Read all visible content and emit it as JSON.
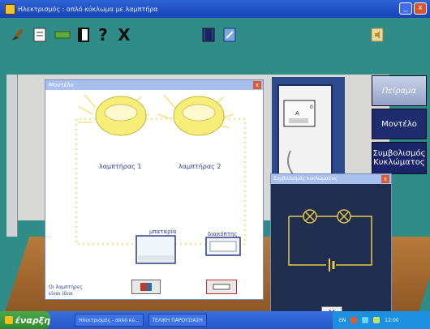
{
  "window": {
    "title": "Ηλεκτρισμός : απλό κύκλωμα με λαμπτήρα",
    "controls": {
      "minimize": "_",
      "close": "x"
    }
  },
  "toolbar": {
    "help_label": "?",
    "close_label": "X",
    "tools": [
      "brush-icon",
      "notepad-icon",
      "tape-icon",
      "book-icon",
      "help-icon",
      "close-icon",
      "door-icon",
      "notebook-icon",
      "speaker-icon"
    ]
  },
  "side_buttons": {
    "peirama": "Πείραμα",
    "montelo": "Μοντέλο",
    "symvolismos_line1": "Συμβολισμός",
    "symvolismos_line2": "Κυκλώματος"
  },
  "background_scene": {
    "meter_reading": "0"
  },
  "montelo_dialog": {
    "title": "Μοντέλο",
    "close": "x",
    "lamp1": "λαμπτήρας 1",
    "lamp2": "λαμπτήρας 2",
    "battery": "μπαταρία",
    "switch": "διακόπτης",
    "note_line1": "Οι λαμπτήρες",
    "note_line2": "είναι ίδιοι"
  },
  "symbol_dialog": {
    "title": "Συμβολισμός κυκλώματος",
    "close": "x",
    "button_close": "✕"
  },
  "taskbar": {
    "start": "έναρξη",
    "task1": "Ηλεκτρισμός - απλό κύ...",
    "task2": "ΤΕΛΙΚΗ ΠΑΡΟΥΣΙΑΣΗ",
    "tray_lang": "EN",
    "clock": "12:00"
  },
  "colors": {
    "titlebar": "#2f63d6",
    "background": "#2f8c86",
    "montelo_button": "#1f2c6e",
    "lamp_glow": "#f5e96b",
    "symbol_bg": "#1f2e4e",
    "symbol_wire": "#e8c84a"
  }
}
